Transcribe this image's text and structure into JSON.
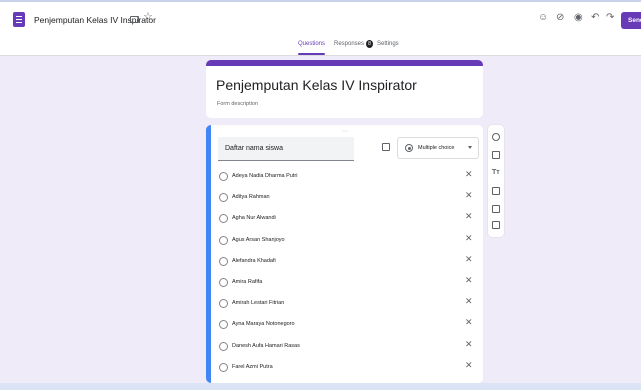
{
  "header": {
    "doc_title": "Penjemputan Kelas IV Inspirator",
    "send_label": "Send"
  },
  "tabs": [
    {
      "label": "Questions",
      "active": true
    },
    {
      "label": "Responses",
      "badge": "8",
      "active": false
    },
    {
      "label": "Settings",
      "active": false
    }
  ],
  "form": {
    "title": "Penjemputan Kelas IV Inspirator",
    "description_placeholder": "Form description"
  },
  "question": {
    "text": "Daftar nama siswa",
    "type": "Multiple choice",
    "options": [
      "Adeya Nadia Dharma Putri",
      "Aditya Rahman",
      "Agha Nur Alwandi",
      "Agus Arsan Shanjoyo",
      "Alefandra Khadafi",
      "Amira Rafifa",
      "Amirah Lestari Fitrian",
      "Ayna Maraya Notonegoro",
      "Danesh Aufa Hamari Rasas",
      "Farel Azmi Putra"
    ]
  },
  "side_toolbar": {
    "icons": [
      "add-question-icon",
      "import-questions-icon",
      "add-title-icon",
      "add-image-icon",
      "add-video-icon",
      "add-section-icon"
    ]
  },
  "colors": {
    "accent": "#673ab7",
    "active_border": "#4285f4",
    "background": "#f0ebf8"
  }
}
